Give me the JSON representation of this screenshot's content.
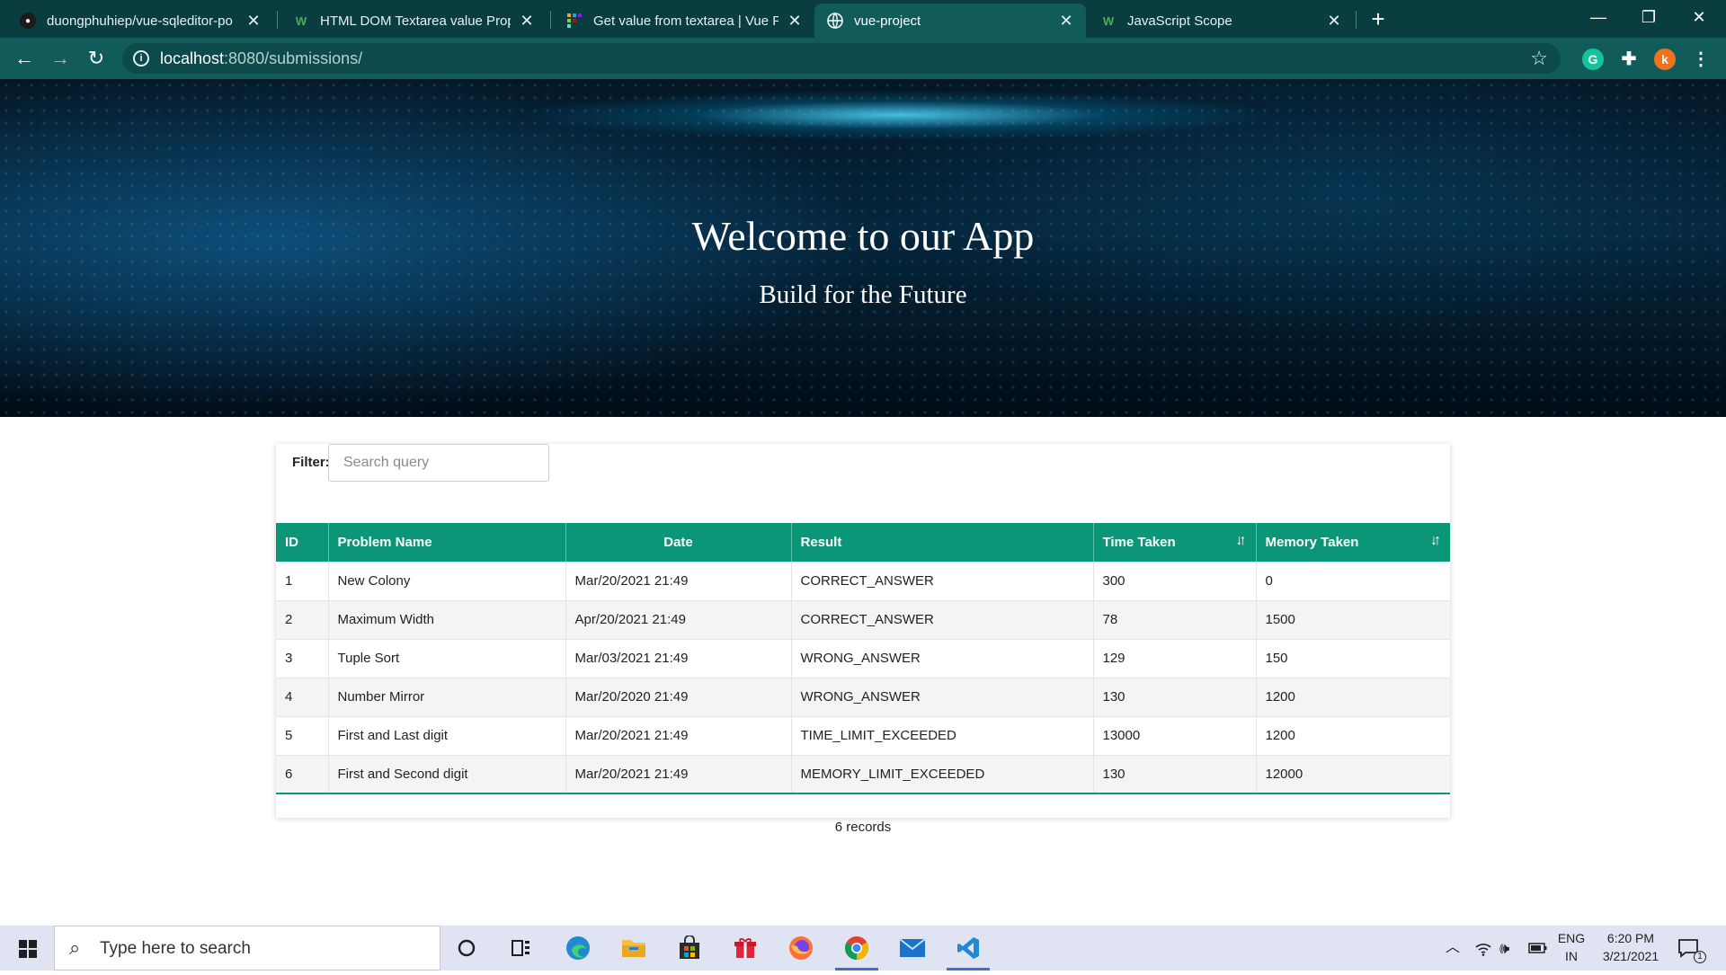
{
  "browser": {
    "tabs": [
      {
        "title": "duongphuhiep/vue-sqleditor-po",
        "icon": "github-icon"
      },
      {
        "title": "HTML DOM Textarea value Prope",
        "icon": "w3schools-icon"
      },
      {
        "title": "Get value from textarea | Vue For",
        "icon": "vue-forum-icon"
      },
      {
        "title": "vue-project",
        "icon": "globe-icon",
        "active": true
      },
      {
        "title": "JavaScript Scope",
        "icon": "w3schools-icon"
      }
    ],
    "url_host": "localhost",
    "url_rest": ":8080/submissions/",
    "profile_initial": "k",
    "extension_initial": "G"
  },
  "hero": {
    "title": "Welcome to our App",
    "subtitle": "Build for the Future"
  },
  "filter": {
    "label": "Filter:",
    "placeholder": "Search query"
  },
  "table": {
    "headers": [
      "ID",
      "Problem Name",
      "Date",
      "Result",
      "Time Taken",
      "Memory Taken"
    ],
    "rows": [
      [
        "1",
        "New Colony",
        "Mar/20/2021 21:49",
        "CORRECT_ANSWER",
        "300",
        "0"
      ],
      [
        "2",
        "Maximum Width",
        "Apr/20/2021 21:49",
        "CORRECT_ANSWER",
        "78",
        "1500"
      ],
      [
        "3",
        "Tuple Sort",
        "Mar/03/2021 21:49",
        "WRONG_ANSWER",
        "129",
        "150"
      ],
      [
        "4",
        "Number Mirror",
        "Mar/20/2020 21:49",
        "WRONG_ANSWER",
        "130",
        "1200"
      ],
      [
        "5",
        "First and Last digit",
        "Mar/20/2021 21:49",
        "TIME_LIMIT_EXCEEDED",
        "13000",
        "1200"
      ],
      [
        "6",
        "First and Second digit",
        "Mar/20/2021 21:49",
        "MEMORY_LIMIT_EXCEEDED",
        "130",
        "12000"
      ]
    ],
    "records": "6 records"
  },
  "taskbar": {
    "search_placeholder": "Type here to search",
    "lang_top": "ENG",
    "lang_bottom": "IN",
    "time": "6:20 PM",
    "date": "3/21/2021",
    "notification_count": "1"
  },
  "colors": {
    "table_header": "#0b9777",
    "browser_frame": "#0a3d3f",
    "browser_toolbar": "#115b5b"
  }
}
